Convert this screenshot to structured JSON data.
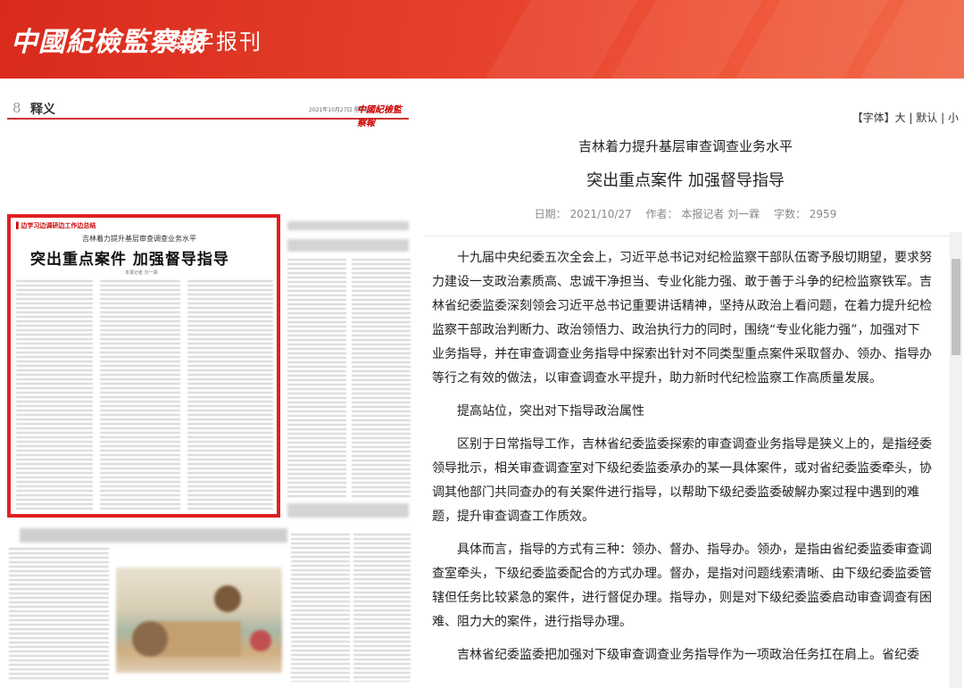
{
  "banner": {
    "logo": "中國紀檢監察報",
    "subtitle": "数字报刊"
  },
  "paper": {
    "page_number": "8",
    "page_name": "释义",
    "date": "2021年10月27日 星期三",
    "brand": "中國紀檢監察報",
    "column_tag": "▌边学习边调研边工作边总结",
    "subheadline": "吉林着力提升基层审查调查业务水平",
    "headline": "突出重点案件  加强督导指导",
    "byline": "本报记者 刘一霖"
  },
  "article": {
    "font_label": "【字体】",
    "font_sizes": [
      "大",
      "默认",
      "小"
    ],
    "subtitle": "吉林着力提升基层审查调查业务水平",
    "title": "突出重点案件 加强督导指导",
    "meta": {
      "date": "日期：  2021/10/27",
      "author": "作者：  本报记者 刘一霖",
      "words": "字数：  2959"
    },
    "paragraphs": [
      "十九届中央纪委五次全会上，习近平总书记对纪检监察干部队伍寄予殷切期望，要求努力建设一支政治素质高、忠诚干净担当、专业化能力强、敢于善于斗争的纪检监察铁军。吉林省纪委监委深刻领会习近平总书记重要讲话精神，坚持从政治上看问题，在着力提升纪检监察干部政治判断力、政治领悟力、政治执行力的同时，围绕“专业化能力强”，加强对下业务指导，并在审查调查业务指导中探索出针对不同类型重点案件采取督办、领办、指导办等行之有效的做法，以审查调查水平提升，助力新时代纪检监察工作高质量发展。",
      "提高站位，突出对下指导政治属性",
      "区别于日常指导工作，吉林省纪委监委探索的审查调查业务指导是狭义上的，是指经委领导批示，相关审查调查室对下级纪委监委承办的某一具体案件，或对省纪委监委牵头，协调其他部门共同查办的有关案件进行指导，以帮助下级纪委监委破解办案过程中遇到的难题，提升审查调查工作质效。",
      "具体而言，指导的方式有三种：领办、督办、指导办。领办，是指由省纪委监委审查调查室牵头，下级纪委监委配合的方式办理。督办，是指对问题线索清晰、由下级纪委监委管辖但任务比较紧急的案件，进行督促办理。指导办，则是对下级纪委监委启动审查调查有困难、阻力大的案件，进行指导办理。",
      "吉林省纪委监委把加强对下级审查调查业务指导作为一项政治任务扛在肩上。省纪委"
    ]
  }
}
